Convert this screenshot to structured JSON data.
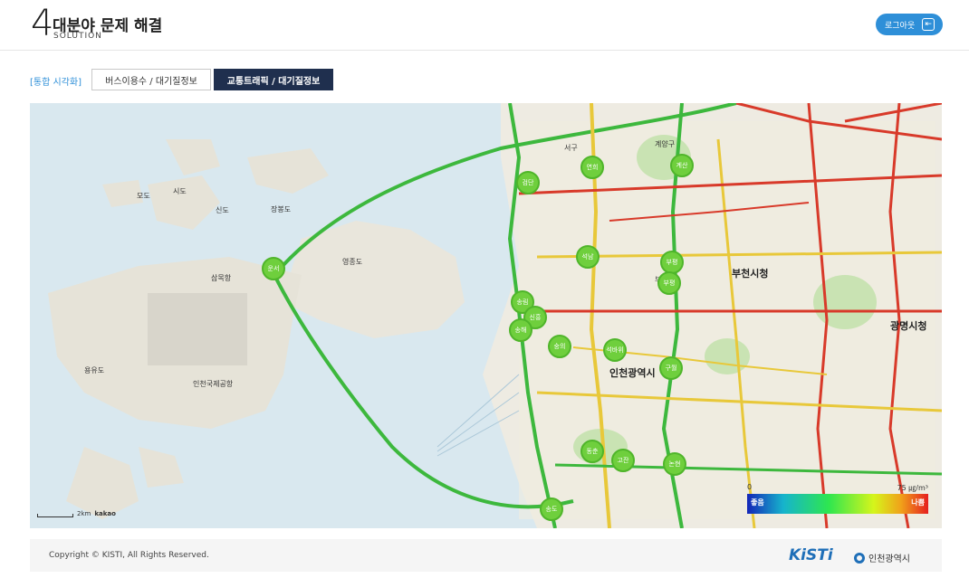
{
  "header": {
    "number": "4",
    "title": "대분야 문제 해결",
    "subtitle": "SOLUTION",
    "logout_label": "로그아웃"
  },
  "tabs": {
    "label": "[통합 시각화]",
    "items": [
      {
        "label": "버스이용수 / 대기질정보",
        "active": false
      },
      {
        "label": "교통트래픽 / 대기질정보",
        "active": true
      }
    ]
  },
  "map": {
    "city_label": "인천광역시",
    "labels": {
      "bucheon": "부천시청",
      "gwangmyeong": "광명시청",
      "yeongjong": "영종도",
      "airport": "인천국제공항",
      "sammok": "삼목항",
      "sindo": "신도",
      "modo": "모도",
      "sido": "시도",
      "jangbong": "장봉도",
      "seogu": "서구",
      "gyeyang": "계양구",
      "bupyeong": "부평",
      "yongyudo": "용유도"
    },
    "stations": [
      {
        "label": "검단"
      },
      {
        "label": "연희"
      },
      {
        "label": "계산"
      },
      {
        "label": "운서"
      },
      {
        "label": "석남"
      },
      {
        "label": "부평"
      },
      {
        "label": "부평"
      },
      {
        "label": "송림"
      },
      {
        "label": "신흥"
      },
      {
        "label": "송해"
      },
      {
        "label": "숭의"
      },
      {
        "label": "석바위"
      },
      {
        "label": "구월"
      },
      {
        "label": "동춘"
      },
      {
        "label": "고잔"
      },
      {
        "label": "논현"
      },
      {
        "label": "송도"
      }
    ],
    "scale_label": "2km",
    "provider": "kakao",
    "legend": {
      "left": "좋음",
      "right": "나쁨",
      "zero": "0",
      "unit": "75 ㎍/m³"
    }
  },
  "footer": {
    "copyright": "Copyright © KISTI, All Rights Reserved.",
    "kisti": "KiSTi",
    "incheon": "인천광역시"
  }
}
